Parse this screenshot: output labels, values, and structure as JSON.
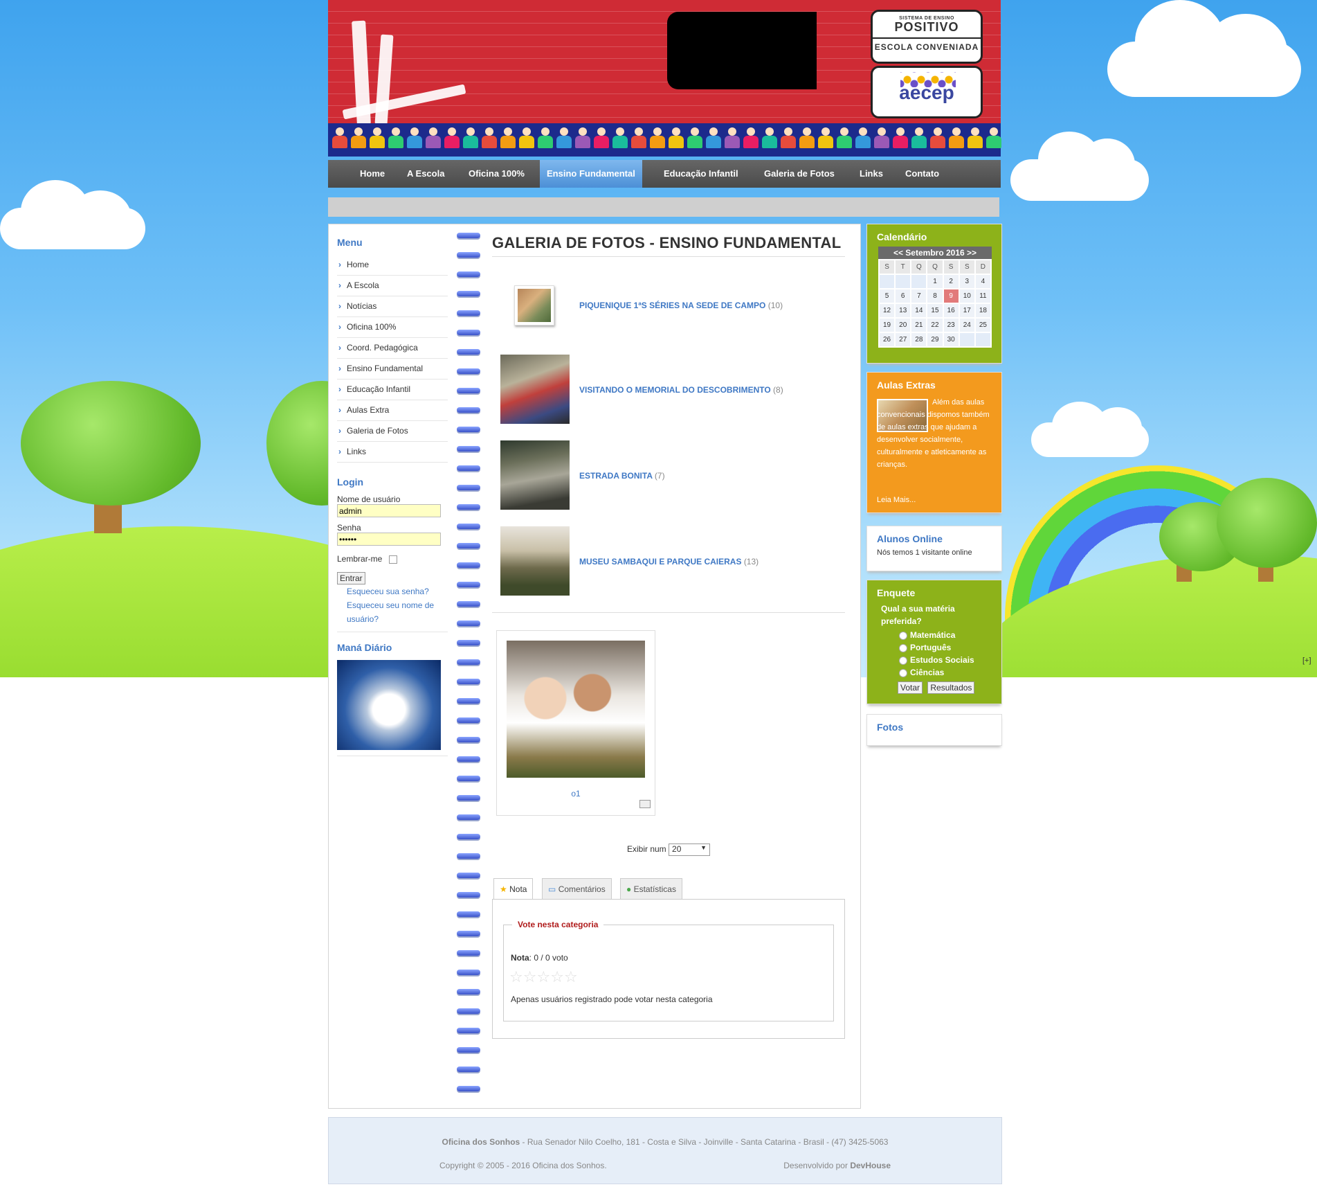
{
  "nav": {
    "items": [
      "Home",
      "A Escola",
      "Oficina 100%",
      "Ensino Fundamental",
      "Educação Infantil",
      "Galeria de Fotos",
      "Links",
      "Contato"
    ],
    "active": "Ensino Fundamental"
  },
  "logos": {
    "positivo_small": "SISTEMA DE ENSINO",
    "positivo_big": "POSITIVO",
    "positivo_sub": "ESCOLA CONVENIADA",
    "aecep": "aecep"
  },
  "left": {
    "menu_title": "Menu",
    "menu": [
      "Home",
      "A Escola",
      "Notícias",
      "Oficina 100%",
      "Coord. Pedagógica",
      "Ensino Fundamental",
      "Educação Infantil",
      "Aulas Extra",
      "Galeria de Fotos",
      "Links"
    ],
    "login_title": "Login",
    "username_label": "Nome de usuário",
    "username_value": "admin",
    "password_label": "Senha",
    "password_value": "••••••",
    "remember_label": "Lembrar-me",
    "submit": "Entrar",
    "forgot_password": "Esqueceu sua senha?",
    "forgot_username": "Esqueceu seu nome de usuário?",
    "mana_title": "Maná Diário"
  },
  "main": {
    "title": "GALERIA DE FOTOS - ENSINO FUNDAMENTAL",
    "albums": [
      {
        "name": "PIQUENIQUE 1ªS SÉRIES NA SEDE DE CAMPO",
        "count": "(10)"
      },
      {
        "name": "VISITANDO O MEMORIAL DO DESCOBRIMENTO",
        "count": "(8)"
      },
      {
        "name": "ESTRADA BONITA",
        "count": "(7)"
      },
      {
        "name": "MUSEU SAMBAQUI E PARQUE CAIERAS",
        "count": "(13)"
      }
    ],
    "photo_caption": "o1",
    "display_label": "Exibir num",
    "display_value": "20",
    "tabs": [
      "Nota",
      "Comentários",
      "Estatísticas"
    ],
    "vote_legend": "Vote nesta categoria",
    "rating_label": "Nota",
    "rating_value": ": 0 / 0 voto",
    "rating_note": "Apenas usuários registrado pode votar nesta categoria"
  },
  "right": {
    "calendar_title": "Calendário",
    "calendar_month": "<<  Setembro 2016  >>",
    "weekdays": [
      "S",
      "T",
      "Q",
      "Q",
      "S",
      "S",
      "D"
    ],
    "weeks": [
      [
        "",
        "",
        "",
        "1",
        "2",
        "3",
        "4"
      ],
      [
        "5",
        "6",
        "7",
        "8",
        "9",
        "10",
        "11"
      ],
      [
        "12",
        "13",
        "14",
        "15",
        "16",
        "17",
        "18"
      ],
      [
        "19",
        "20",
        "21",
        "22",
        "23",
        "24",
        "25"
      ],
      [
        "26",
        "27",
        "28",
        "29",
        "30",
        "",
        ""
      ]
    ],
    "today": "9",
    "extras_title": "Aulas Extras",
    "extras_text": "Além das aulas convencionais dispomos também de aulas extras que ajudam a desenvolver socialmente, culturalmente e atleticamente as crianças.",
    "extras_more": "Leia Mais...",
    "online_title": "Alunos Online",
    "online_text": "Nós temos 1 visitante online",
    "poll_title": "Enquete",
    "poll_question": "Qual a sua matéria preferida?",
    "poll_options": [
      "Matemática",
      "Português",
      "Estudos Sociais",
      "Ciências"
    ],
    "poll_vote": "Votar",
    "poll_results": "Resultados",
    "photos_title": "Fotos"
  },
  "footer": {
    "school": "Oficina dos Sonhos",
    "address": " - Rua Senador Nilo Coelho, 181 - Costa e Silva - Joinville - Santa Catarina - Brasil - (47) 3425-5063",
    "copyright": "Copyright © 2005 - 2016 Oficina dos Sonhos.",
    "dev_label": "Desenvolvido por ",
    "dev_name": "DevHouse"
  },
  "corner_toggle": "[+]"
}
